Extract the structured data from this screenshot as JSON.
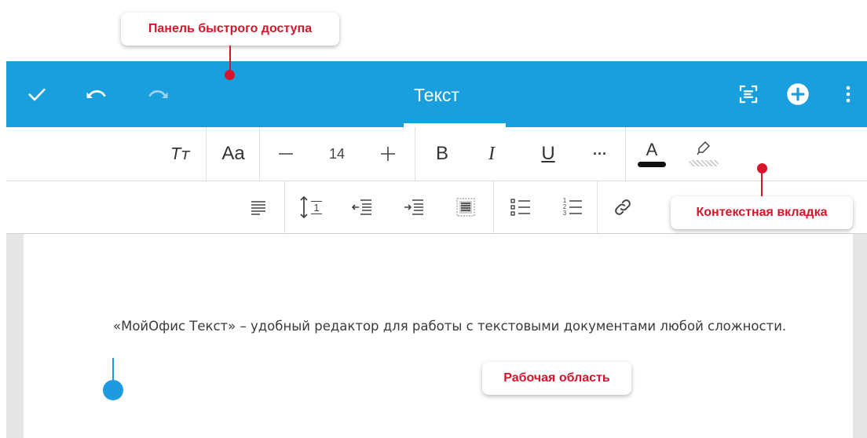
{
  "quick_access_bar": {
    "title": "Текст",
    "icons": [
      "check-icon",
      "undo-icon",
      "redo-icon",
      "scan-text-icon",
      "add-icon",
      "more-vertical-icon"
    ],
    "colors": {
      "background": "#1a9fde",
      "foreground": "#ffffff"
    }
  },
  "formatting_toolbar": {
    "text_style_label": "Тт",
    "font_label": "Aa",
    "font_size": "14",
    "bold_label": "B",
    "italic_label": "I",
    "underline_label": "U",
    "more_label": "···",
    "font_color_label": "A"
  },
  "paragraph_toolbar": {
    "icons": [
      "align-justify-icon",
      "line-spacing-icon",
      "decrease-indent-icon",
      "increase-indent-icon",
      "text-wrap-icon",
      "bulleted-list-icon",
      "numbered-list-icon",
      "link-icon"
    ],
    "line_spacing_label": "1",
    "numbered_list_labels": [
      "1",
      "2",
      "3"
    ]
  },
  "document": {
    "text": "«МойОфис Текст» – удобный редактор для работы с текстовыми документами любой сложности."
  },
  "annotations": {
    "quick_access": "Панель быстрого доступа",
    "context_tab": "Контекстная вкладка",
    "workspace": "Рабочая область",
    "color": "#d9142a"
  },
  "cursor_color": "#1e9be0"
}
